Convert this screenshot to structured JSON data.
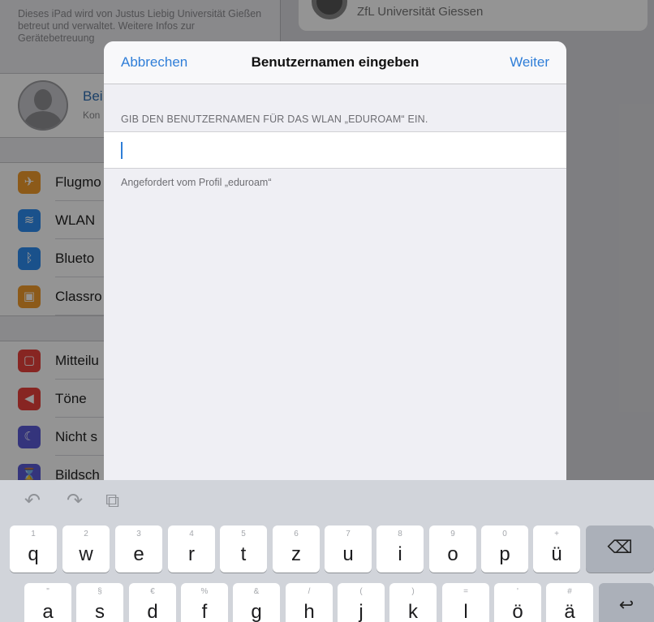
{
  "background": {
    "management_text": "Dieses iPad wird von Justus Liebig Universität Gießen betreut und verwaltet. Weitere Infos zur Gerätebetreuung",
    "profile": {
      "name": "Bei",
      "subtitle": "Kon"
    },
    "group1": [
      {
        "label": "Flugmo",
        "icon": "airplane-icon",
        "glyph": "✈",
        "color": "#f29c2b"
      },
      {
        "label": "WLAN",
        "icon": "wifi-icon",
        "glyph": "≋",
        "color": "#2d8cf0"
      },
      {
        "label": "Blueto",
        "icon": "bluetooth-icon",
        "glyph": "ᛒ",
        "color": "#2d8cf0"
      },
      {
        "label": "Classro",
        "icon": "classroom-icon",
        "glyph": "▣",
        "color": "#f29c2b"
      }
    ],
    "group2": [
      {
        "label": "Mitteilu",
        "icon": "notifications-icon",
        "glyph": "▢",
        "color": "#e8413c"
      },
      {
        "label": "Töne",
        "icon": "sounds-icon",
        "glyph": "◀",
        "color": "#e8413c"
      },
      {
        "label": "Nicht s",
        "icon": "do-not-disturb-icon",
        "glyph": "☾",
        "color": "#5b5bd6"
      },
      {
        "label": "Bildsch",
        "icon": "screen-time-icon",
        "glyph": "⌛",
        "color": "#5b5bd6"
      }
    ],
    "detail_title": "ZfL Universität Giessen"
  },
  "modal": {
    "cancel_label": "Abbrechen",
    "title": "Benutzernamen eingeben",
    "next_label": "Weiter",
    "field_header": "GIB DEN BENUTZERNAMEN FÜR DAS WLAN „EDUROAM“ EIN.",
    "username_value": "",
    "field_footer": "Angefordert vom Profil „eduroam“"
  },
  "keyboard": {
    "toolbar": [
      {
        "name": "undo-icon",
        "glyph": "↶"
      },
      {
        "name": "redo-icon",
        "glyph": "↷"
      },
      {
        "name": "paste-icon",
        "glyph": "⧉"
      }
    ],
    "row1": [
      {
        "ch": "q",
        "hint": "1"
      },
      {
        "ch": "w",
        "hint": "2"
      },
      {
        "ch": "e",
        "hint": "3"
      },
      {
        "ch": "r",
        "hint": "4"
      },
      {
        "ch": "t",
        "hint": "5"
      },
      {
        "ch": "z",
        "hint": "6"
      },
      {
        "ch": "u",
        "hint": "7"
      },
      {
        "ch": "i",
        "hint": "8"
      },
      {
        "ch": "o",
        "hint": "9"
      },
      {
        "ch": "p",
        "hint": "0"
      },
      {
        "ch": "ü",
        "hint": "+"
      }
    ],
    "row2": [
      {
        "ch": "a",
        "hint": "\""
      },
      {
        "ch": "s",
        "hint": "§"
      },
      {
        "ch": "d",
        "hint": "€"
      },
      {
        "ch": "f",
        "hint": "%"
      },
      {
        "ch": "g",
        "hint": "&"
      },
      {
        "ch": "h",
        "hint": "/"
      },
      {
        "ch": "j",
        "hint": "("
      },
      {
        "ch": "k",
        "hint": ")"
      },
      {
        "ch": "l",
        "hint": "="
      },
      {
        "ch": "ö",
        "hint": "'"
      },
      {
        "ch": "ä",
        "hint": "#"
      }
    ],
    "delete_glyph": "⌫",
    "return_glyph": "↩"
  }
}
